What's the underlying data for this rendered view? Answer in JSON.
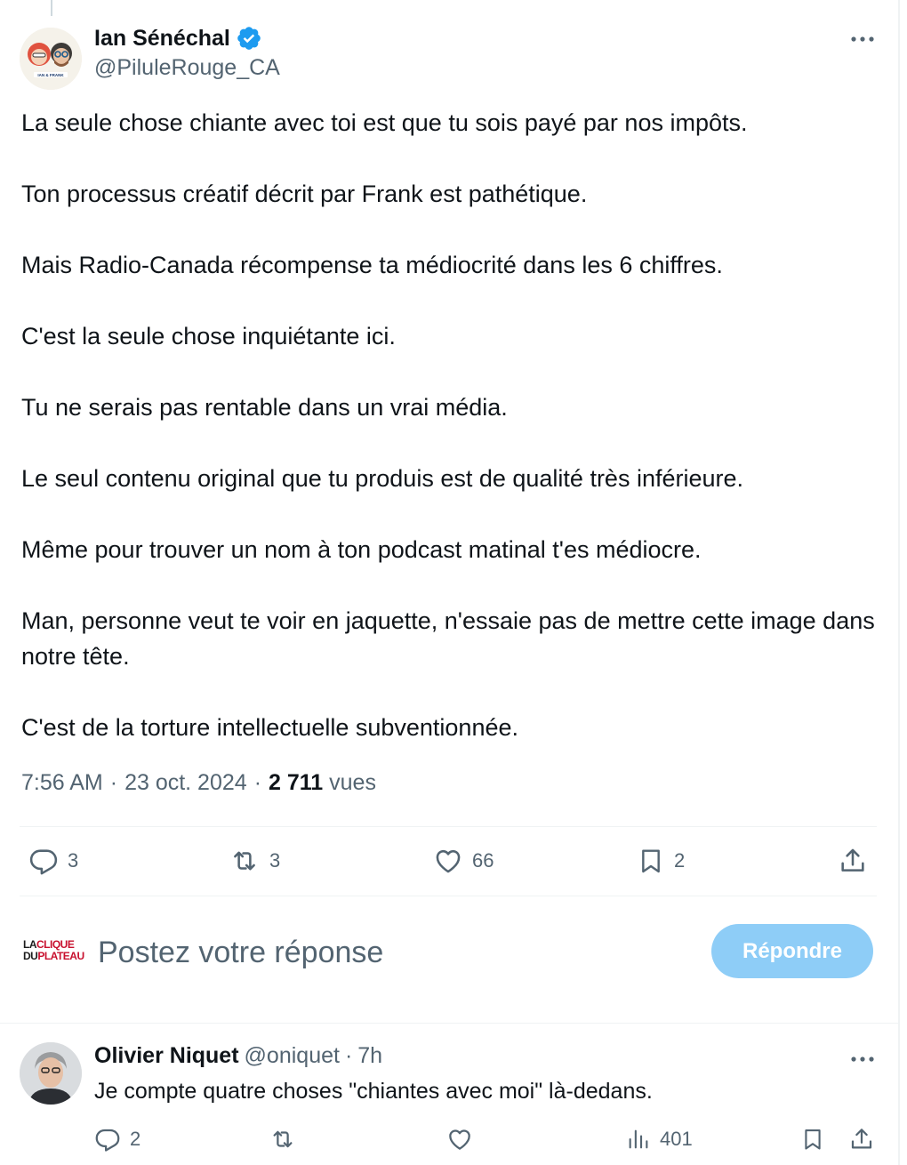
{
  "tweet": {
    "author": {
      "display_name": "Ian Sénéchal",
      "handle": "@PiluleRouge_CA",
      "verified": true,
      "avatar_icon": "avatar-two-cartoon-faces",
      "avatar_caption": "IAN & FRANK"
    },
    "paragraphs": [
      "La seule chose chiante avec toi est que tu sois payé par nos impôts.",
      "Ton processus créatif décrit par Frank est pathétique.",
      "Mais Radio-Canada récompense ta médiocrité dans les 6 chiffres.",
      "C'est la seule chose inquiétante ici.",
      "Tu ne serais pas rentable dans un vrai média.",
      "Le seul contenu original que tu produis est de qualité très inférieure.",
      "Même pour trouver un nom à ton podcast matinal t'es médiocre.",
      "Man, personne veut te voir en jaquette, n'essaie pas de mettre cette image dans notre tête.",
      "C'est de la torture intellectuelle subventionnée."
    ],
    "time": "7:56 AM",
    "separator": "·",
    "date": "23 oct. 2024",
    "views_count": "2 711",
    "views_label": "vues",
    "actions": {
      "replies": "3",
      "reposts": "3",
      "likes": "66",
      "bookmarks": "2"
    }
  },
  "composer": {
    "logo_line1_a": "LA",
    "logo_line1_b": "CLIQUE",
    "logo_line2_a": "DU",
    "logo_line2_b": "PLATEAU",
    "placeholder": "Postez votre réponse",
    "button_label": "Répondre"
  },
  "reply": {
    "display_name": "Olivier Niquet",
    "handle": "@oniquet",
    "separator": "·",
    "time": "7h",
    "text": "Je compte quatre choses \"chiantes avec moi\" là-dedans.",
    "actions": {
      "replies": "2",
      "views": "401"
    }
  },
  "colors": {
    "accent": "#1d9bf0",
    "button_disabled": "#8ecdf7",
    "secondary_text": "#536471",
    "divider": "#eff3f4"
  }
}
